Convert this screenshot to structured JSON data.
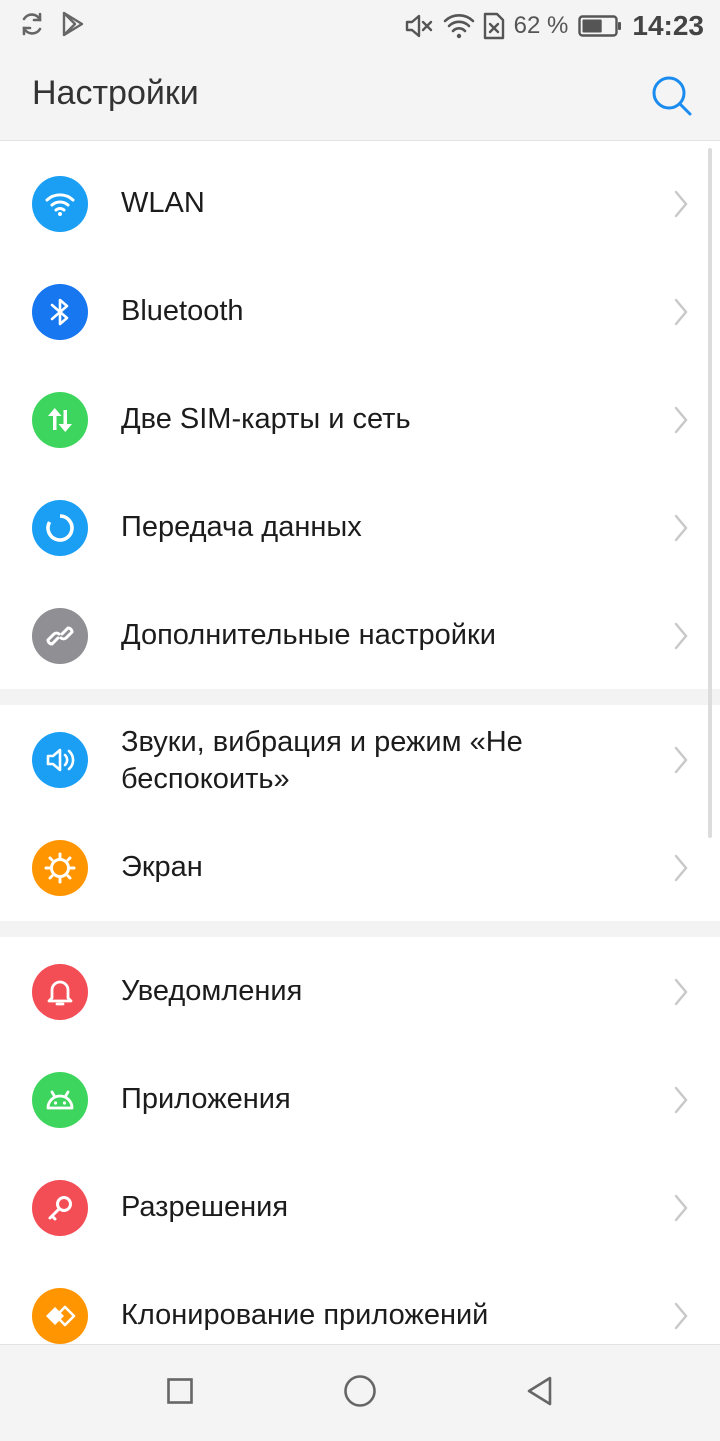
{
  "status_bar": {
    "battery_percent": "62 %",
    "time": "14:23",
    "battery_level": 0.62,
    "left_icons": [
      "sync-icon",
      "play-store-icon"
    ],
    "right_icons": [
      "mute-icon",
      "wifi-icon",
      "no-sim-icon",
      "battery-icon"
    ]
  },
  "app_bar": {
    "title": "Настройки",
    "search_icon": "search-icon"
  },
  "settings": {
    "items": [
      {
        "label": "WLAN",
        "icon": "wifi-icon",
        "color": "#1a9ff5"
      },
      {
        "label": "Bluetooth",
        "icon": "bluetooth-icon",
        "color": "#1677f0"
      },
      {
        "label": "Две SIM-карты и сеть",
        "icon": "mobile-data-icon",
        "color": "#3dd55d"
      },
      {
        "label": "Передача данных",
        "icon": "data-usage-icon",
        "color": "#1a9ff5"
      },
      {
        "label": "Дополнительные настройки",
        "icon": "link-icon",
        "color": "#8f8f94"
      },
      {
        "label": "Звуки, вибрация и режим «Не беспокоить»",
        "icon": "speaker-icon",
        "color": "#1a9ff5"
      },
      {
        "label": "Экран",
        "icon": "brightness-icon",
        "color": "#ff9500"
      },
      {
        "label": "Уведомления",
        "icon": "bell-icon",
        "color": "#f34d55"
      },
      {
        "label": "Приложения",
        "icon": "android-icon",
        "color": "#3dd55d"
      },
      {
        "label": "Разрешения",
        "icon": "key-icon",
        "color": "#f34d55"
      },
      {
        "label": "Клонирование приложений",
        "icon": "clone-icon",
        "color": "#ff9500"
      }
    ]
  },
  "nav_bar": {
    "icons": [
      "recents-square-icon",
      "home-circle-icon",
      "back-triangle-icon"
    ]
  }
}
